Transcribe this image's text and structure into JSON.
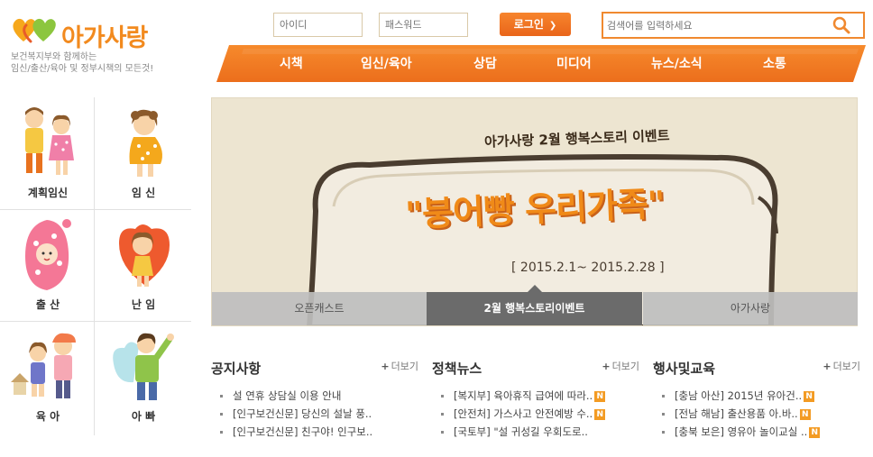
{
  "brand": {
    "logo_text": "아가사랑",
    "tagline1": "보건복지부와 함께하는",
    "tagline2": "임신/출산/육아 및 정부시책의 모든것!",
    "accent": "#f28a1e"
  },
  "login": {
    "id_placeholder": "아이디",
    "pw_placeholder": "패스워드",
    "button_label": "로그인",
    "button_icon": "chevron-right-icon"
  },
  "search": {
    "placeholder": "검색어를 입력하세요",
    "icon": "search-icon"
  },
  "nav": {
    "items": [
      "시책",
      "임신/육아",
      "상담",
      "미디어",
      "뉴스/소식",
      "소통"
    ]
  },
  "categories": [
    {
      "label": "계획임신",
      "icon": "couple-icon"
    },
    {
      "label": "임 신",
      "icon": "pregnant-woman-icon"
    },
    {
      "label": "출 산",
      "icon": "newborn-baby-icon"
    },
    {
      "label": "난 임",
      "icon": "girl-heart-icon"
    },
    {
      "label": "육 아",
      "icon": "children-icon"
    },
    {
      "label": "아 빠",
      "icon": "dad-icon"
    }
  ],
  "banner": {
    "title": "아가사랑 2월 행복스토리 이벤트",
    "slogan": "\"붕어빵 우리가족\"",
    "date": "[ 2015.2.1~ 2015.2.28 ]",
    "tabs": [
      "오픈캐스트",
      "2월 행복스토리이벤트",
      "아가사랑"
    ],
    "active_tab": 1
  },
  "boards": [
    {
      "title": "공지사항",
      "more": "더보기",
      "items": [
        {
          "text": "설 연휴 상담실 이용 안내",
          "new": false
        },
        {
          "text": "[인구보건신문] 당신의 설날 풍..",
          "new": false
        },
        {
          "text": "[인구보건신문] 친구야! 인구보..",
          "new": false
        }
      ]
    },
    {
      "title": "정책뉴스",
      "more": "더보기",
      "items": [
        {
          "text": "[복지부] 육아휴직 급여에 따라..",
          "new": true
        },
        {
          "text": "[안전처] 가스사고 안전예방 수..",
          "new": true
        },
        {
          "text": "[국토부] \"설 귀성길 우회도로..",
          "new": false
        }
      ]
    },
    {
      "title": "행사및교육",
      "more": "더보기",
      "items": [
        {
          "text": "[충남 아산] 2015년 유아건..",
          "new": true
        },
        {
          "text": "[전남 해남] 출산용품 아.바..",
          "new": true
        },
        {
          "text": "[충북 보은] 영유아 놀이교실 ..",
          "new": true
        }
      ]
    }
  ],
  "new_badge": "N"
}
